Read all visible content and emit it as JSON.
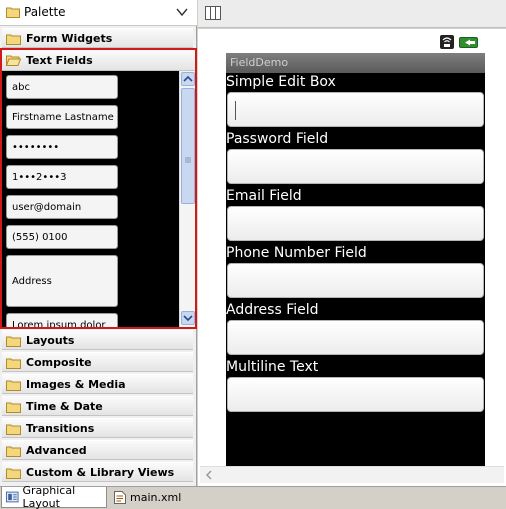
{
  "palette": {
    "title": "Palette",
    "categories": {
      "form_widgets": "Form Widgets",
      "text_fields": "Text Fields",
      "layouts": "Layouts",
      "composite": "Composite",
      "images_media": "Images & Media",
      "time_date": "Time & Date",
      "transitions": "Transitions",
      "advanced": "Advanced",
      "custom_library_views": "Custom & Library Views"
    },
    "text_field_items": {
      "plain": "abc",
      "person_name": "Firstname Lastname",
      "password": "••••••••",
      "password_numeric": "1•••2•••3",
      "email": "user@domain",
      "phone": "(555) 0100",
      "postal_address": "Address",
      "multiline": "Lorem ipsum dolor"
    }
  },
  "device": {
    "app_title": "FieldDemo",
    "fields": {
      "simple_edit_box": {
        "label": "Simple Edit Box",
        "value": ""
      },
      "password_field": {
        "label": "Password Field",
        "value": ""
      },
      "email_field": {
        "label": "Email Field",
        "value": ""
      },
      "phone_number_field": {
        "label": "Phone Number Field",
        "value": ""
      },
      "address_field": {
        "label": "Address Field",
        "value": ""
      },
      "multiline_text": {
        "label": "Multiline Text",
        "value": ""
      }
    }
  },
  "editor_tabs": {
    "graphical_layout": "Graphical Layout",
    "main_xml": "main.xml"
  },
  "colors": {
    "selection_border": "#d11919",
    "device_background": "#000000",
    "title_bar": "#6b6b6b",
    "scrollbar": "#c8d8f0"
  }
}
